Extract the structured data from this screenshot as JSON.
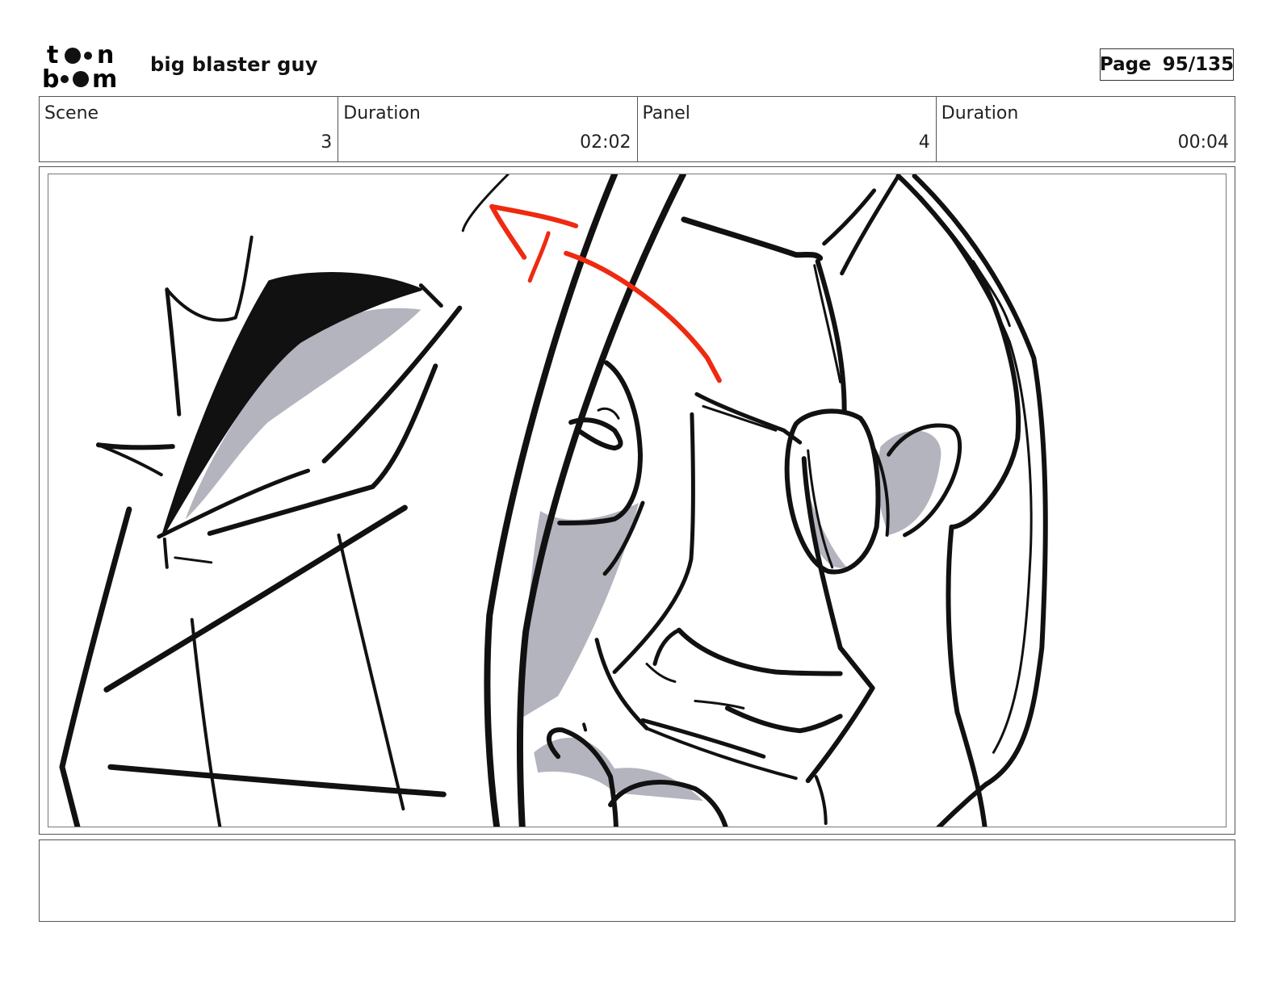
{
  "header": {
    "logo_text": "toon boom",
    "project_title": "big blaster guy",
    "page_label": "Page",
    "page_number": "95/135"
  },
  "info": {
    "scene_label": "Scene",
    "scene_value": "3",
    "scene_duration_label": "Duration",
    "scene_duration_value": "02:02",
    "panel_label": "Panel",
    "panel_value": "4",
    "panel_duration_label": "Duration",
    "panel_duration_value": "00:04"
  },
  "panel": {
    "stroke_color": "#111111",
    "shadow_color": "#b3b4be",
    "annotation_color": "#ee2a10"
  },
  "notes": {
    "text": ""
  }
}
